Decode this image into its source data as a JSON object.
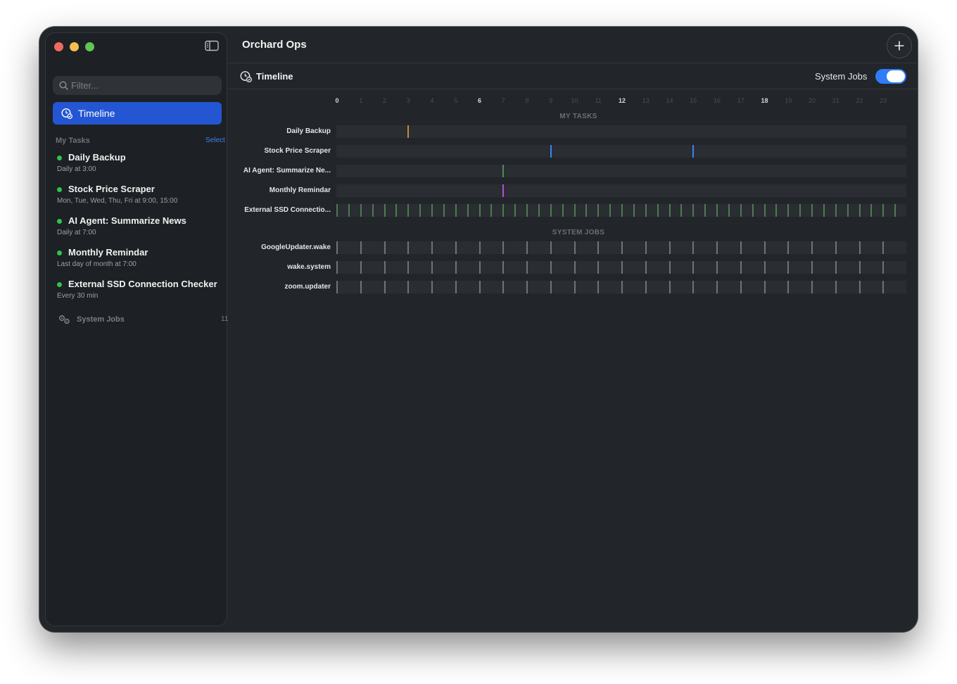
{
  "window": {
    "sidebar_toggle_icon": "sidebar-icon"
  },
  "sidebar": {
    "filter_placeholder": "Filter...",
    "nav_item": {
      "label": "Timeline",
      "icon": "clock-badge-icon",
      "selected": true,
      "accent": "#2456d3"
    },
    "section_header": "My Tasks",
    "select_label": "Select",
    "tasks": [
      {
        "name": "Daily Backup",
        "schedule": "Daily at 3:00",
        "status_color": "#2fc34f"
      },
      {
        "name": "Stock Price Scraper",
        "schedule": "Mon, Tue, Wed, Thu, Fri at 9:00, 15:00",
        "status_color": "#2fc34f"
      },
      {
        "name": "AI Agent: Summarize News",
        "schedule": "Daily at 7:00",
        "status_color": "#2fc34f"
      },
      {
        "name": "Monthly Remindar",
        "schedule": "Last day of month at 7:00",
        "status_color": "#2fc34f"
      },
      {
        "name": "External SSD Connection Checker",
        "schedule": "Every 30 min",
        "status_color": "#2fc34f"
      }
    ],
    "system_jobs": {
      "label": "System Jobs",
      "count": "11",
      "icon": "gears-icon"
    }
  },
  "main": {
    "title": "Orchard Ops",
    "add_icon": "plus-icon",
    "subtitle": "Timeline",
    "subtitle_icon": "clock-badge-icon",
    "system_jobs_toggle_label": "System Jobs",
    "system_jobs_toggle_on": true
  },
  "timeline": {
    "hours": [
      "0",
      "1",
      "2",
      "3",
      "4",
      "5",
      "6",
      "7",
      "8",
      "9",
      "10",
      "11",
      "12",
      "13",
      "14",
      "15",
      "16",
      "17",
      "18",
      "19",
      "20",
      "21",
      "22",
      "23"
    ],
    "major_hours": [
      "0",
      "6",
      "12",
      "18"
    ],
    "groups": [
      {
        "header": "MY TASKS",
        "rows": [
          {
            "label": "Daily Backup",
            "color": "#c28a3c",
            "times": [
              3
            ]
          },
          {
            "label": "Stock Price Scraper",
            "color": "#3b82f6",
            "times": [
              9,
              15
            ]
          },
          {
            "label": "AI Agent: Summarize Ne...",
            "color": "#4f8a55",
            "times": [
              7
            ]
          },
          {
            "label": "Monthly Remindar",
            "color": "#b14fd8",
            "times": [
              7
            ]
          },
          {
            "label": "External SSD Connectio...",
            "color": "#4f7a52",
            "interval_hours": 0.5
          }
        ]
      },
      {
        "header": "SYSTEM JOBS",
        "rows": [
          {
            "label": "GoogleUpdater.wake",
            "color": "#6f7278",
            "interval_hours": 1
          },
          {
            "label": "wake.system",
            "color": "#6f7278",
            "interval_hours": 1
          },
          {
            "label": "zoom.updater",
            "color": "#6f7278",
            "interval_hours": 1
          }
        ]
      }
    ]
  }
}
